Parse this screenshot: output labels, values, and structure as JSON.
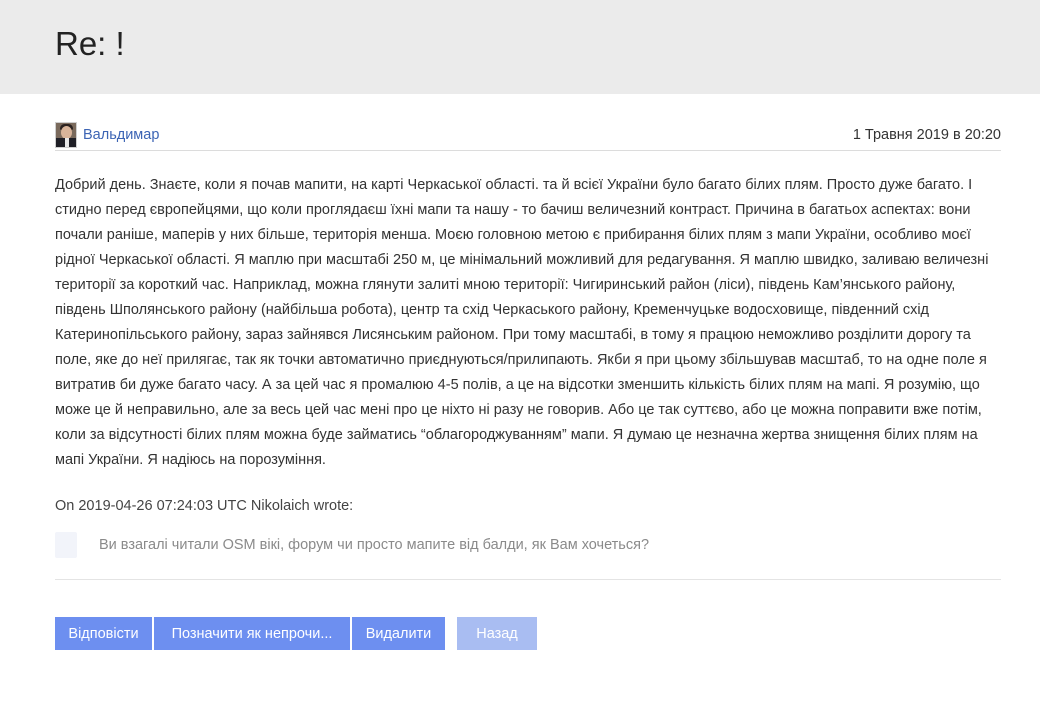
{
  "header": {
    "title": "Re: !"
  },
  "message": {
    "author": "Вальдимар",
    "timestamp": "1 Травня 2019 в 20:20",
    "body": "Добрий день. Знаєте, коли я почав мапити, на карті Черкаської області. та й всієї України було багато білих плям. Просто дуже багато. І стидно перед європейцями, що коли проглядаєш їхні мапи та нашу - то бачиш величезний контраст. Причина в багатьох аспектах: вони почали раніше, маперів у них більше, територія менша. Моєю головною метою є прибирання білих плям з мапи України, особливо моєї рідної Черкаської області. Я маплю при масштабі 250 м, це мінімальний можливий для редагування. Я маплю швидко, заливаю величезні території за короткий час. Наприклад, можна глянути залиті мною території: Чигиринський район (ліси), південь Кам’янського району, південь Шполянського району (найбільша робота), центр та схід Черкаського району, Кременчуцьке водосховище, південний схід Катеринопільського району, зараз зайнявся Лисянським районом. При тому масштабі, в тому я працюю неможливо розділити дорогу та поле, яке до неї прилягає, так як точки автоматично приєднуються/прилипають. Якби я при цьому збільшував масштаб, то на одне поле я витратив би дуже багато часу. А за цей час я промалюю 4-5 полів, а це на відсотки зменшить кількість білих плям на мапі. Я розумію, що може це й неправильно, але за весь цей час мені про це ніхто ні разу не говорив. Або це так суттєво, або це можна поправити вже потім, коли за відсутності білих плям можна буде займатись “облагороджуванням” мапи. Я думаю це незначна жертва знищення білих плям на мапі України. Я надіюсь на порозуміння.",
    "quote_intro": "On 2019-04-26 07:24:03 UTC Nikolaich wrote:",
    "quote_text": "Ви взагалі читали OSM вікі, форум чи просто мапите від балди, як Вам хочеться?"
  },
  "actions": {
    "reply": "Відповісти",
    "mark_unread": "Позначити як непрочи...",
    "delete": "Видалити",
    "back": "Назад"
  },
  "colors": {
    "header_bg": "#ebebeb",
    "link": "#3c64b4",
    "button": "#6d8ff0",
    "button_disabled": "#a9bdf2"
  },
  "icons": {
    "avatar": "user-avatar-photo",
    "quote_marker": "quote-indicator"
  }
}
